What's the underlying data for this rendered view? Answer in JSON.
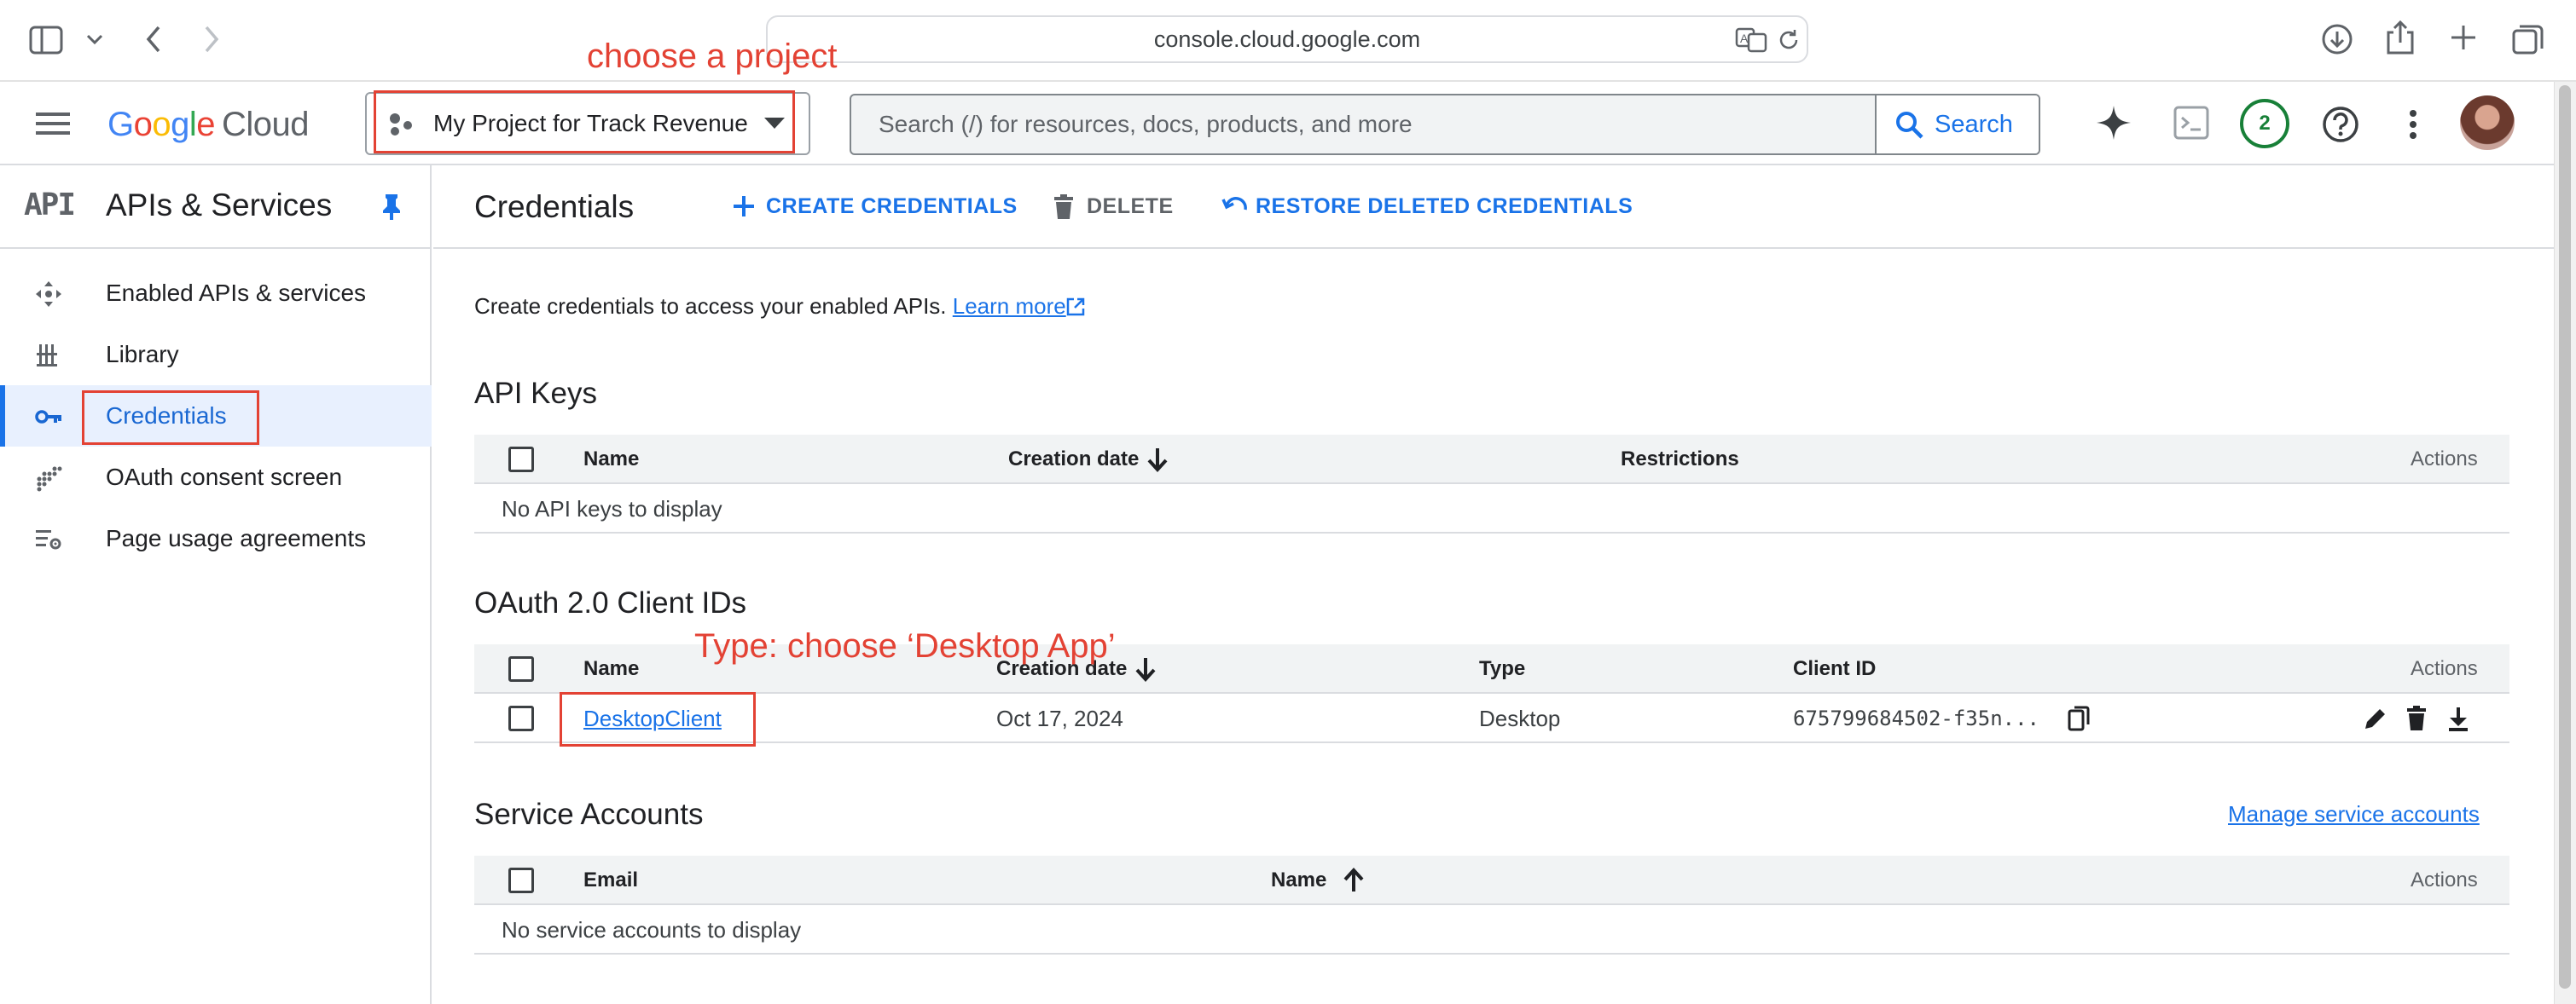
{
  "browser": {
    "url": "console.cloud.google.com"
  },
  "header": {
    "logo": {
      "brand": "Google",
      "product": "Cloud"
    },
    "project_name": "My Project for Track Revenue",
    "search_placeholder": "Search (/) for resources, docs, products, and more",
    "search_button": "Search",
    "notification_count": "2"
  },
  "sidebar": {
    "logo_text": "API",
    "title": "APIs & Services",
    "items": [
      {
        "label": "Enabled APIs & services",
        "icon": "hub-icon",
        "active": false
      },
      {
        "label": "Library",
        "icon": "library-icon",
        "active": false
      },
      {
        "label": "Credentials",
        "icon": "key-icon",
        "active": true
      },
      {
        "label": "OAuth consent screen",
        "icon": "dots-icon",
        "active": false
      },
      {
        "label": "Page usage agreements",
        "icon": "settings-list-icon",
        "active": false
      }
    ]
  },
  "main": {
    "title": "Credentials",
    "actions": {
      "create": "CREATE CREDENTIALS",
      "delete": "DELETE",
      "restore": "RESTORE DELETED CREDENTIALS"
    },
    "intro": "Create credentials to access your enabled APIs.",
    "learn_more": "Learn more",
    "api_keys": {
      "title": "API Keys",
      "columns": {
        "name": "Name",
        "created": "Creation date",
        "restrictions": "Restrictions",
        "actions": "Actions"
      },
      "empty": "No API keys to display"
    },
    "oauth": {
      "title": "OAuth 2.0 Client IDs",
      "columns": {
        "name": "Name",
        "created": "Creation date",
        "type": "Type",
        "client_id": "Client ID",
        "actions": "Actions"
      },
      "rows": [
        {
          "name": "DesktopClient",
          "created": "Oct 17, 2024",
          "type": "Desktop",
          "client_id": "675799684502-f35n..."
        }
      ]
    },
    "service_accounts": {
      "title": "Service Accounts",
      "manage_link": "Manage service accounts",
      "columns": {
        "email": "Email",
        "name": "Name",
        "actions": "Actions"
      },
      "empty": "No service accounts to display"
    }
  },
  "annotations": {
    "project": "choose a project",
    "type": "Type: choose ‘Desktop App’"
  },
  "colors": {
    "accent": "#1a73e8",
    "annotation": "#e34234",
    "active_bg": "#e8f0fe"
  }
}
